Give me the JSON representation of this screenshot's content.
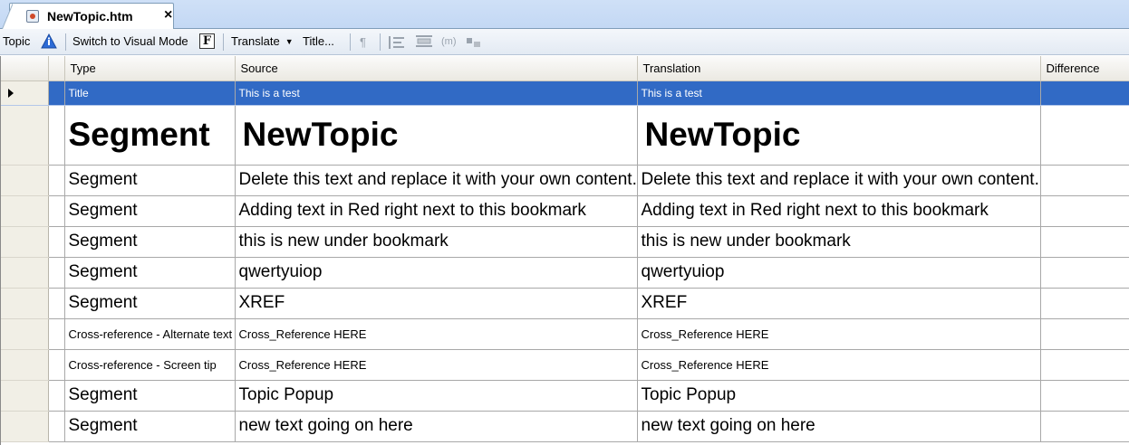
{
  "tab": {
    "title": "NewTopic.htm",
    "close": "×"
  },
  "toolbar": {
    "topic_label": "Topic",
    "switch_label": "Switch to Visual Mode",
    "translate_label": "Translate",
    "title_label": "Title...",
    "pilcrow": "¶"
  },
  "columns": [
    "Type",
    "Source",
    "Translation",
    "Difference"
  ],
  "rows": [
    {
      "type": "Title",
      "source": "This is a test",
      "translation": "This is a test",
      "difference": "",
      "style": "selected"
    },
    {
      "type": "Segment",
      "source": "NewTopic",
      "translation": "NewTopic",
      "difference": "",
      "style": "big"
    },
    {
      "type": "Segment",
      "source": "Delete this text and replace it with your own content.",
      "translation": "Delete this text and replace it with your own content.",
      "difference": "",
      "style": "norm"
    },
    {
      "type": "Segment",
      "source": "Adding text in Red right next to this bookmark",
      "translation": "Adding text in Red right next to this bookmark",
      "difference": "",
      "style": "norm"
    },
    {
      "type": "Segment",
      "source": "this is new under bookmark",
      "translation": "this is new under bookmark",
      "difference": "",
      "style": "norm"
    },
    {
      "type": "Segment",
      "source": "qwertyuiop",
      "translation": "qwertyuiop",
      "difference": "",
      "style": "norm"
    },
    {
      "type": "Segment",
      "source": "XREF",
      "translation": "XREF",
      "difference": "",
      "style": "norm"
    },
    {
      "type": "Cross-reference - Alternate text",
      "source": "Cross_Reference HERE",
      "translation": "Cross_Reference HERE",
      "difference": "",
      "style": "small"
    },
    {
      "type": "Cross-reference - Screen tip",
      "source": "Cross_Reference HERE",
      "translation": "Cross_Reference HERE",
      "difference": "",
      "style": "small"
    },
    {
      "type": "Segment",
      "source": "Topic Popup",
      "translation": "Topic Popup",
      "difference": "",
      "style": "norm"
    },
    {
      "type": "Segment",
      "source": "new text going on here",
      "translation": "new text going on here",
      "difference": "",
      "style": "norm"
    }
  ],
  "colors": {
    "selection": "#316ac5",
    "tabstrip": "#c3d8f4",
    "header": "#ebe9e2"
  },
  "icons": [
    "document-icon",
    "info-icon",
    "format-icon",
    "dropdown-arrow-icon",
    "pilcrow-icon",
    "align-icon",
    "layout-icon",
    "field-icon",
    "tag-icon",
    "row-pointer-icon"
  ]
}
